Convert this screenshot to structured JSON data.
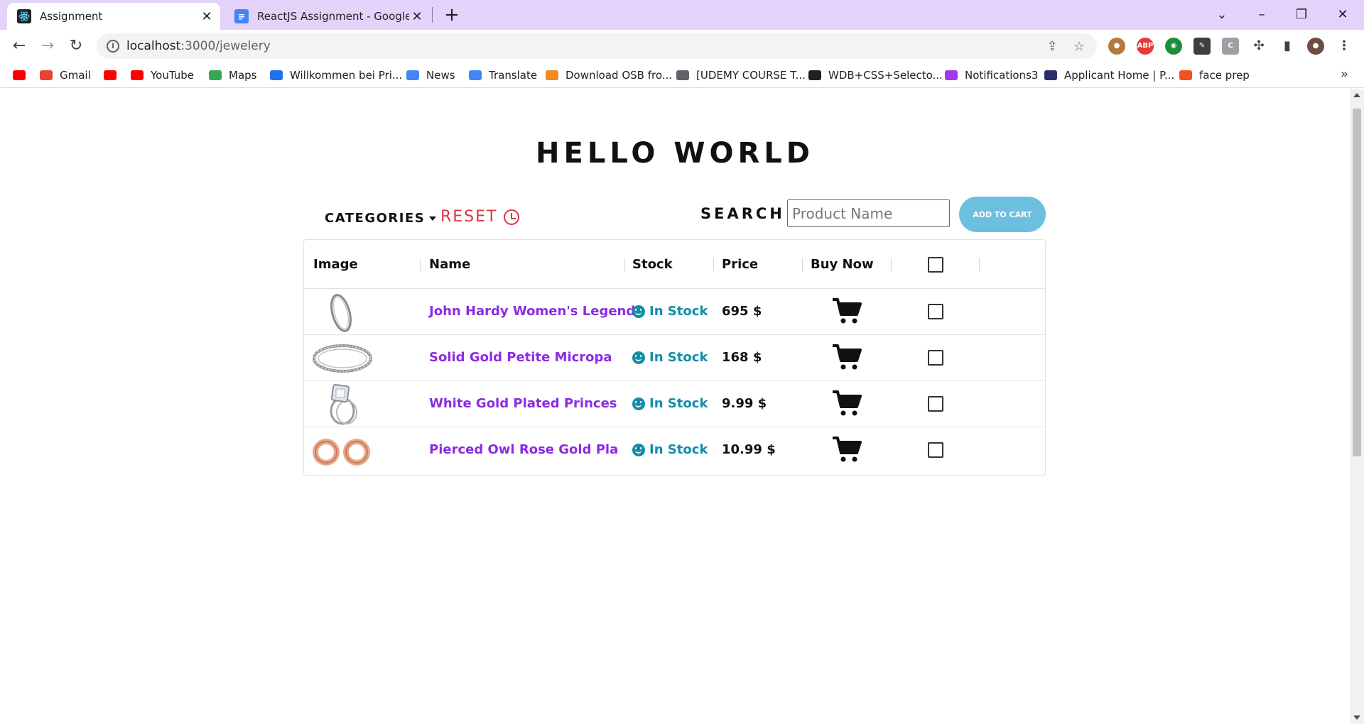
{
  "browser": {
    "tabs": [
      {
        "title": "Assignment",
        "icon": "react-icon",
        "active": true
      },
      {
        "title": "ReactJS Assignment - Google Do",
        "icon": "google-docs-icon",
        "active": false
      }
    ],
    "url_host": "localhost",
    "url_path": ":3000/jewelery",
    "bookmarks": [
      {
        "label": "",
        "icon": "youtube-icon",
        "color": "#ff0000"
      },
      {
        "label": "Gmail",
        "icon": "gmail-icon",
        "color": "#ea4335"
      },
      {
        "label": "",
        "icon": "youtube-icon",
        "color": "#ff0000"
      },
      {
        "label": "YouTube",
        "icon": "youtube-icon",
        "color": "#ff0000"
      },
      {
        "label": "Maps",
        "icon": "maps-icon",
        "color": "#34a853"
      },
      {
        "label": "Willkommen bei Pri...",
        "icon": "prime-video-icon",
        "color": "#1a73e8"
      },
      {
        "label": "News",
        "icon": "google-news-icon",
        "color": "#4285f4"
      },
      {
        "label": "Translate",
        "icon": "translate-icon",
        "color": "#4285f4"
      },
      {
        "label": "Download OSB fro...",
        "icon": "osb-icon",
        "color": "#f28b20"
      },
      {
        "label": "[UDEMY COURSE T...",
        "icon": "udemy-icon",
        "color": "#5f6368"
      },
      {
        "label": "WDB+CSS+Selecto...",
        "icon": "globe-icon",
        "color": "#202124"
      },
      {
        "label": "Notifications3",
        "icon": "udemy-icon",
        "color": "#a435f0"
      },
      {
        "label": "Applicant Home | P...",
        "icon": "applicant-icon",
        "color": "#2b2b6b"
      },
      {
        "label": "face prep",
        "icon": "faceprep-icon",
        "color": "#f4511e"
      }
    ]
  },
  "page": {
    "heading": "HELLO WORLD",
    "categories_label": "CATEGORIES",
    "reset_label": "RESET",
    "search_label": "SEARCH :",
    "search_placeholder": "Product Name",
    "add_to_cart_label": "ADD TO CART",
    "columns": [
      "Image",
      "Name",
      "Stock",
      "Price",
      "Buy Now"
    ],
    "products": [
      {
        "name": "John Hardy Women's Legend",
        "stock": "In Stock",
        "price": "695 $",
        "image": "silver-bracelet"
      },
      {
        "name": "Solid Gold Petite Micropa",
        "stock": "In Stock",
        "price": "168 $",
        "image": "silver-ring-band"
      },
      {
        "name": "White Gold Plated Princes",
        "stock": "In Stock",
        "price": "9.99 $",
        "image": "diamond-ring"
      },
      {
        "name": "Pierced Owl Rose Gold Pla",
        "stock": "In Stock",
        "price": "10.99 $",
        "image": "rose-gold-plugs"
      }
    ]
  },
  "colors": {
    "tabbar": "#e3d3fa",
    "product_name": "#8b2be2",
    "stock": "#138da8",
    "reset": "#dc3545",
    "add_to_cart": "#6dbfe0"
  }
}
